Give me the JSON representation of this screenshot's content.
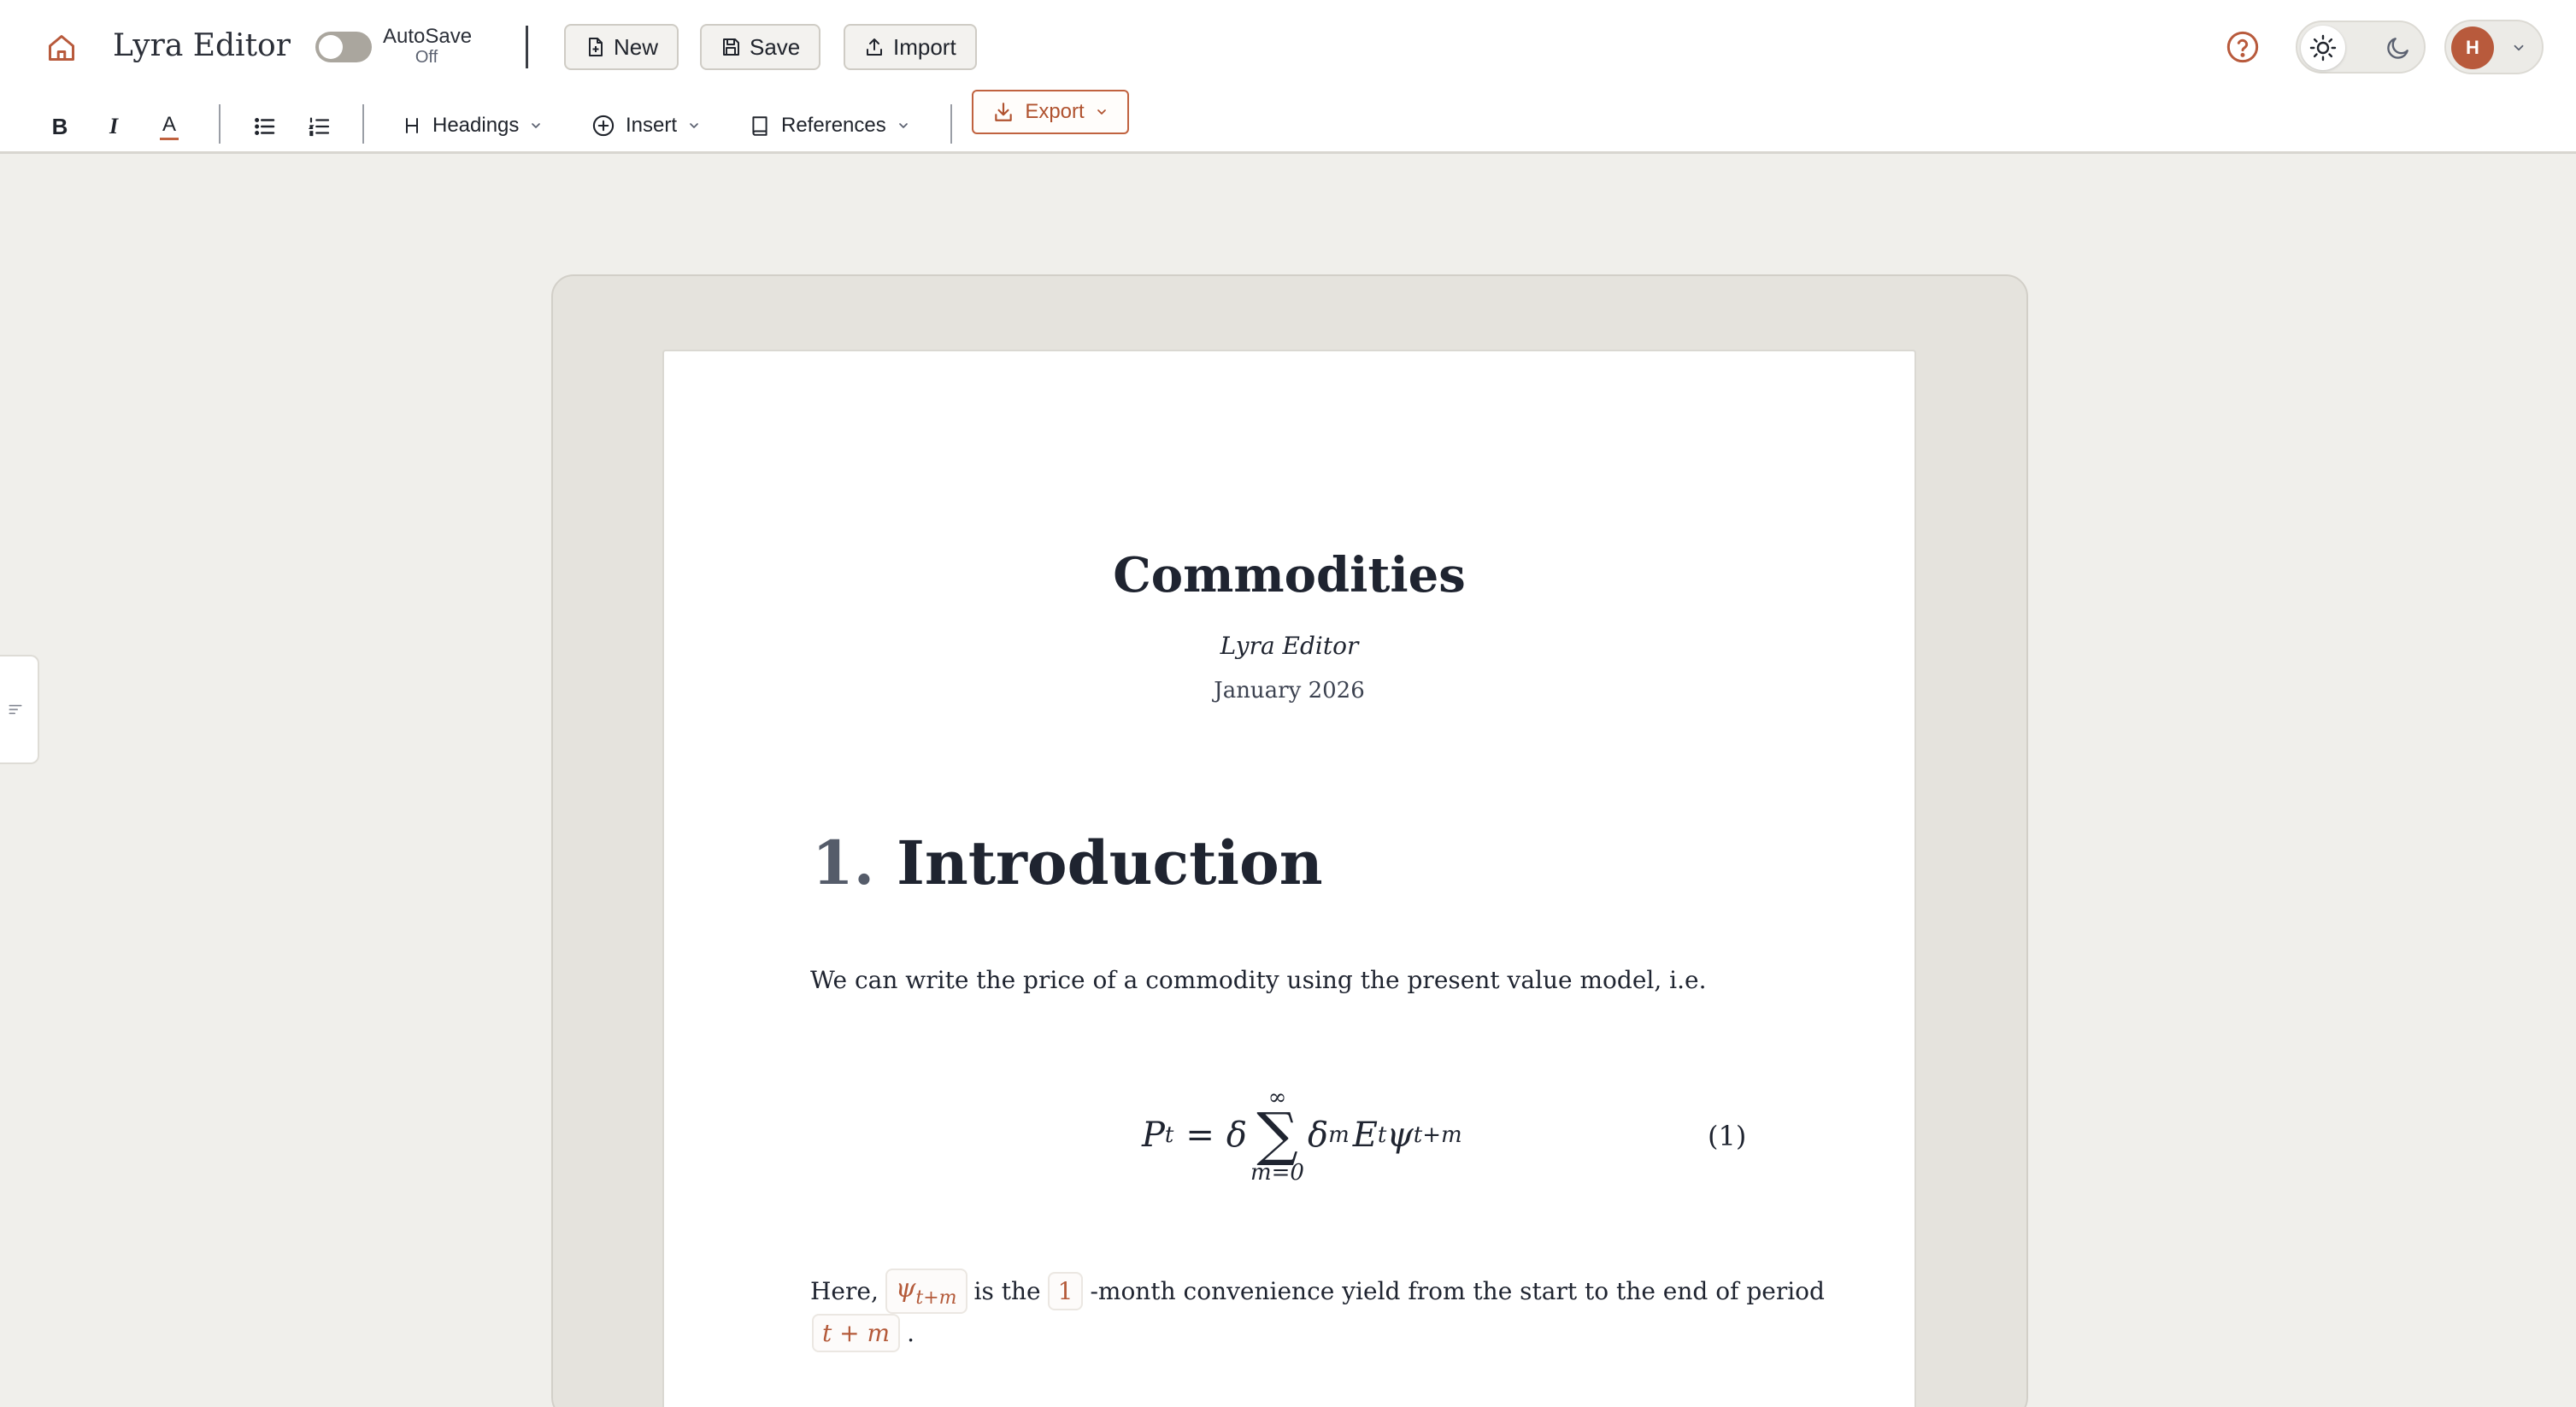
{
  "app": {
    "title": "Lyra Editor",
    "accent_color": "#b85a3c",
    "home_icon": "home-icon"
  },
  "autosave": {
    "label": "AutoSave",
    "state": "Off"
  },
  "file_actions": {
    "new_label": "New",
    "save_label": "Save",
    "import_label": "Import"
  },
  "header_right": {
    "help_icon": "help-circle-icon",
    "theme_light_icon": "sun-icon",
    "theme_dark_icon": "moon-icon",
    "theme_active": "light",
    "user_initial": "H"
  },
  "toolbar": {
    "bold": "B",
    "italic": "I",
    "text_color": "A",
    "headings_label": "Headings",
    "insert_label": "Insert",
    "references_label": "References",
    "export_label": "Export"
  },
  "document": {
    "title": "Commodities",
    "author": "Lyra Editor",
    "date": "January 2026",
    "section": {
      "number": "1.",
      "title": "Introduction"
    },
    "paragraph1": "We can write the price of a commodity using the present value model, i.e.",
    "equation_number": "(1)",
    "paragraph2": {
      "lead": "Here,",
      "chip_psi_sub": "t+m",
      "mid": "is the",
      "chip_one": "1",
      "tail": "-month convenience yield from the start to the end of period",
      "chip_tm": "t + m",
      "end": "."
    }
  }
}
